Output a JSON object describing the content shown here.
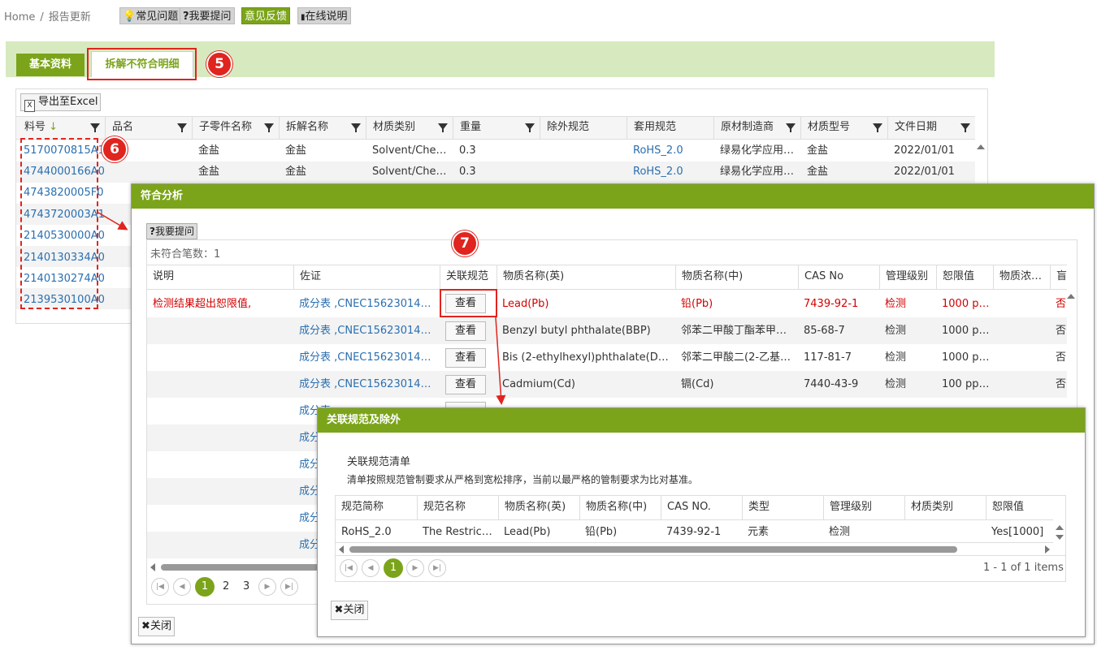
{
  "breadcrumb": {
    "home": "Home",
    "sep": "/",
    "current": "报告更新"
  },
  "toolbar": {
    "faq": "常见问题",
    "ask": "我要提问",
    "feedback": "意见反馈",
    "help": "在线说明"
  },
  "tabs": {
    "basic": "基本资料",
    "detail": "拆解不符合明细"
  },
  "callouts": {
    "c5": "5",
    "c6": "6",
    "c7": "7"
  },
  "main_grid": {
    "export_label": "导出至Excel",
    "columns": [
      "料号",
      "品名",
      "子零件名称",
      "拆解名称",
      "材质类别",
      "重量",
      "除外规范",
      "套用规范",
      "原材制造商",
      "材质型号",
      "文件日期"
    ],
    "rows": [
      {
        "part": "5170070815A1",
        "name": "",
        "sub": "金盐",
        "dis": "金盐",
        "cat": "Solvent/Che…",
        "weight": "0.3",
        "exempt": "",
        "spec": "RoHS_2.0",
        "maker": "绿易化学应用…",
        "model": "金盐",
        "date": "2022/01/01"
      },
      {
        "part": "4744000166A0",
        "name": "",
        "sub": "金盐",
        "dis": "金盐",
        "cat": "Solvent/Che…",
        "weight": "0.3",
        "exempt": "",
        "spec": "RoHS_2.0",
        "maker": "绿易化学应用…",
        "model": "金盐",
        "date": "2022/01/01"
      },
      {
        "part": "4743820005F0"
      },
      {
        "part": "4743720003A1"
      },
      {
        "part": "2140530000A0"
      },
      {
        "part": "2140130334A0"
      },
      {
        "part": "2140130274A0"
      },
      {
        "part": "2139530100A0"
      }
    ]
  },
  "dialog1": {
    "title": "符合分析",
    "ask_label": "我要提问",
    "count_text": "未符合笔数：1",
    "columns": [
      "说明",
      "佐证",
      "关联规范",
      "物质名称(英)",
      "物质名称(中)",
      "CAS No",
      "管理级别",
      "恕限值",
      "物质浓…",
      "盲"
    ],
    "view_label": "查看",
    "rows": [
      {
        "desc": "检测结果超出恕限值,",
        "evidence": "成分表 ,CNEC156230142…",
        "en": "Lead(Pb)",
        "zh": "铅(Pb)",
        "cas": "7439-92-1",
        "level": "检测",
        "limit": "1000 p…",
        "conc": "",
        "flag": "否",
        "bad": true
      },
      {
        "desc": "",
        "evidence": "成分表 ,CNEC156230142…",
        "en": "Benzyl butyl phthalate(BBP)",
        "zh": "邻苯二甲酸丁酯苯甲…",
        "cas": "85-68-7",
        "level": "检测",
        "limit": "1000 ppm",
        "conc": "",
        "flag": "否"
      },
      {
        "desc": "",
        "evidence": "成分表 ,CNEC156230142…",
        "en": "Bis (2-ethylhexyl)phthalate(DEHP)",
        "zh": "邻苯二甲酸二(2-乙基…",
        "cas": "117-81-7",
        "level": "检测",
        "limit": "1000 ppm",
        "conc": "",
        "flag": "否"
      },
      {
        "desc": "",
        "evidence": "成分表 ,CNEC156230142…",
        "en": "Cadmium(Cd)",
        "zh": "镉(Cd)",
        "cas": "7440-43-9",
        "level": "检测",
        "limit": "100 pp…",
        "conc": "",
        "flag": "否"
      },
      {
        "evidence": "成分表"
      },
      {
        "evidence": "成分"
      },
      {
        "evidence": "成分"
      },
      {
        "evidence": "成分"
      },
      {
        "evidence": "成分"
      },
      {
        "evidence": "成分"
      }
    ],
    "pager": {
      "p1": "1",
      "p2": "2",
      "p3": "3"
    },
    "close_label": "关闭"
  },
  "dialog2": {
    "title": "关联规范及除外",
    "subtitle": "关联规范清单",
    "note": "清单按照规范管制要求从严格到宽松排序，当前以最严格的管制要求为比对基准。",
    "columns": [
      "规范简称",
      "规范名称",
      "物质名称(英)",
      "物质名称(中)",
      "CAS NO.",
      "类型",
      "管理级别",
      "材质类别",
      "恕限值"
    ],
    "row": {
      "abbr": "RoHS_2.0",
      "name": "The Restrict…",
      "en": "Lead(Pb)",
      "zh": "铅(Pb)",
      "cas": "7439-92-1",
      "type": "元素",
      "level": "检测",
      "cat": "",
      "limit": "Yes[1000]"
    },
    "pager": {
      "current": "1",
      "summary": "1 - 1 of 1 items"
    },
    "close_label": "关闭"
  },
  "colors": {
    "accent": "#7ba41a",
    "highlight": "#e0241e",
    "link": "#2a6fb0",
    "error": "#d40000"
  }
}
